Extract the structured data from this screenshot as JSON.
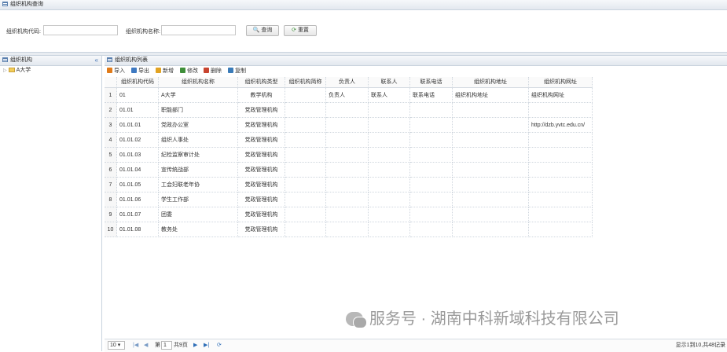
{
  "search": {
    "title": "组织机构查询",
    "code_label": "组织机构代码:",
    "name_label": "组织机构名称:",
    "code_value": "",
    "name_value": "",
    "query_label": "查询",
    "reset_label": "重置"
  },
  "tree": {
    "title": "组织机构",
    "collapse": "«",
    "root_label": "A大学"
  },
  "list": {
    "title": "组织机构列表",
    "toolbar": [
      {
        "label": "导入",
        "color": "#e07b1a"
      },
      {
        "label": "导出",
        "color": "#3e79c1"
      },
      {
        "label": "新增",
        "color": "#e2a322"
      },
      {
        "label": "修改",
        "color": "#3f8f3a"
      },
      {
        "label": "删除",
        "color": "#c8442f"
      },
      {
        "label": "复制",
        "color": "#3a7bb8"
      }
    ],
    "columns": [
      "组织机构代码",
      "组织机构名称",
      "组织机构类型",
      "组织机构简称",
      "负责人",
      "联系人",
      "联系电话",
      "组织机构地址",
      "组织机构网址"
    ],
    "rows": [
      {
        "n": "1",
        "code": "01",
        "name": "A大学",
        "type": "教学机构",
        "short": "",
        "head": "负责人",
        "contact": "联系人",
        "phone": "联系电话",
        "addr": "组织机构地址",
        "url": "组织机构网址"
      },
      {
        "n": "2",
        "code": "01.01",
        "name": "职能部门",
        "type": "党政管理机构",
        "short": "",
        "head": "",
        "contact": "",
        "phone": "",
        "addr": "",
        "url": ""
      },
      {
        "n": "3",
        "code": "01.01.01",
        "name": "党政办公室",
        "type": "党政管理机构",
        "short": "",
        "head": "",
        "contact": "",
        "phone": "",
        "addr": "",
        "url": "http://dzb.yvtc.edu.cn/"
      },
      {
        "n": "4",
        "code": "01.01.02",
        "name": "组织人事处",
        "type": "党政管理机构",
        "short": "",
        "head": "",
        "contact": "",
        "phone": "",
        "addr": "",
        "url": ""
      },
      {
        "n": "5",
        "code": "01.01.03",
        "name": "纪检监察审计处",
        "type": "党政管理机构",
        "short": "",
        "head": "",
        "contact": "",
        "phone": "",
        "addr": "",
        "url": ""
      },
      {
        "n": "6",
        "code": "01.01.04",
        "name": "宣传统战部",
        "type": "党政管理机构",
        "short": "",
        "head": "",
        "contact": "",
        "phone": "",
        "addr": "",
        "url": ""
      },
      {
        "n": "7",
        "code": "01.01.05",
        "name": "工会妇联老年协",
        "type": "党政管理机构",
        "short": "",
        "head": "",
        "contact": "",
        "phone": "",
        "addr": "",
        "url": ""
      },
      {
        "n": "8",
        "code": "01.01.06",
        "name": "学生工作部",
        "type": "党政管理机构",
        "short": "",
        "head": "",
        "contact": "",
        "phone": "",
        "addr": "",
        "url": ""
      },
      {
        "n": "9",
        "code": "01.01.07",
        "name": "团委",
        "type": "党政管理机构",
        "short": "",
        "head": "",
        "contact": "",
        "phone": "",
        "addr": "",
        "url": ""
      },
      {
        "n": "10",
        "code": "01.01.08",
        "name": "教务处",
        "type": "党政管理机构",
        "short": "",
        "head": "",
        "contact": "",
        "phone": "",
        "addr": "",
        "url": ""
      }
    ]
  },
  "pager": {
    "page_size": "10",
    "page_num": "1",
    "page_prefix": "第",
    "page_total": "共9页",
    "summary": "显示1到10,共48记录"
  },
  "watermark": {
    "text": "服务号 · 湖南中科新域科技有限公司"
  }
}
